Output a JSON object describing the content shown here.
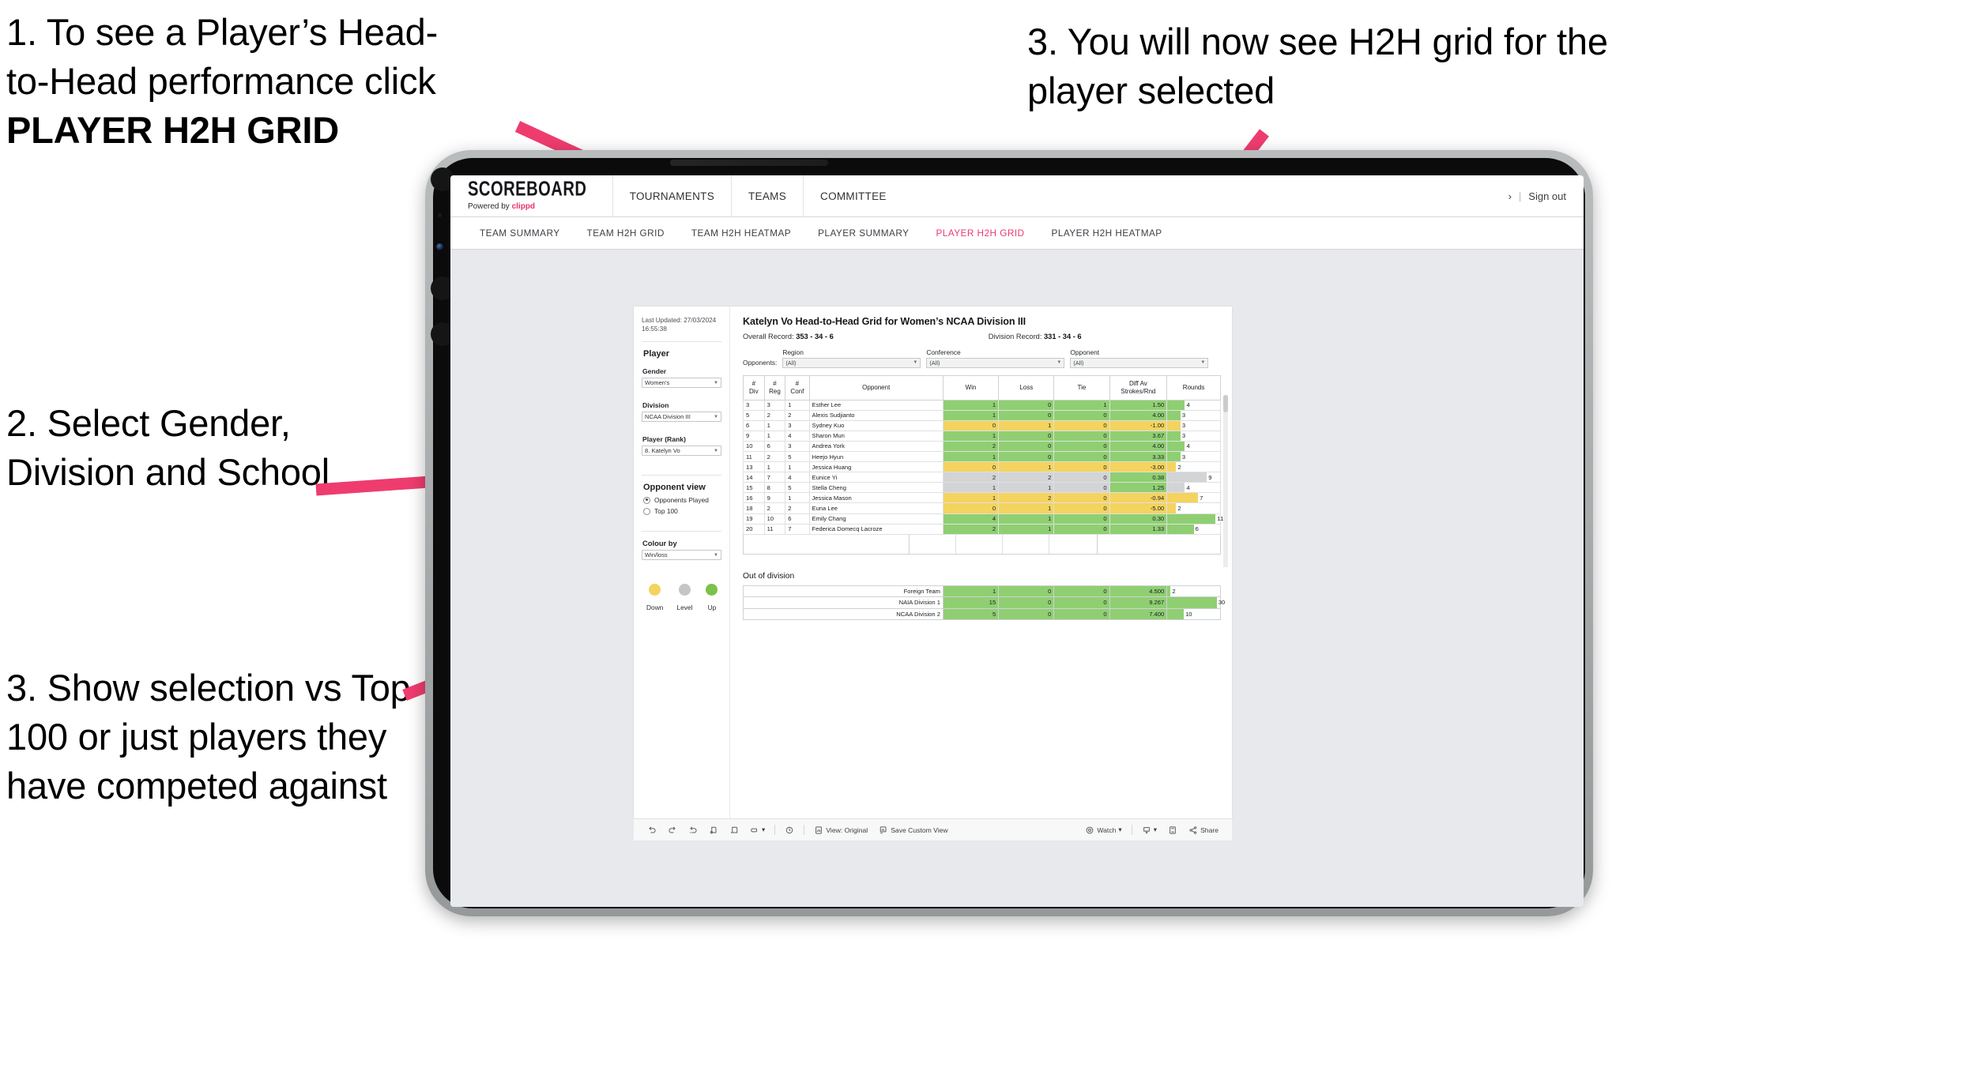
{
  "annotations": {
    "step1_line1": "1. To see a Player’s Head-",
    "step1_line2": "to-Head performance click",
    "step1_bold": "PLAYER H2H GRID",
    "step2": "2. Select Gender, Division and School",
    "step3_left": "3. Show selection vs Top 100 or just players they have competed against",
    "step3_right": "3. You will now see H2H grid for the player selected"
  },
  "app": {
    "brand": "SCOREBOARD",
    "brand_sub_prefix": "Powered by ",
    "brand_sub_accent": "clippd",
    "accent_color": "#e8336d",
    "nav": [
      {
        "label": "TOURNAMENTS"
      },
      {
        "label": "TEAMS"
      },
      {
        "label": "COMMITTEE"
      }
    ],
    "header_right": {
      "chevron": "›",
      "separator": "|",
      "sign_out": "Sign out"
    },
    "tabs": [
      {
        "label": "TEAM SUMMARY",
        "active": false
      },
      {
        "label": "TEAM H2H GRID",
        "active": false
      },
      {
        "label": "TEAM H2H HEATMAP",
        "active": false
      },
      {
        "label": "PLAYER SUMMARY",
        "active": false
      },
      {
        "label": "PLAYER H2H GRID",
        "active": true
      },
      {
        "label": "PLAYER H2H HEATMAP",
        "active": false
      }
    ]
  },
  "sidebar": {
    "last_updated": "Last Updated: 27/03/2024 16:55:38",
    "player_section": "Player",
    "gender_label": "Gender",
    "gender_value": "Women's",
    "division_label": "Division",
    "division_value": "NCAA Division III",
    "player_rank_label": "Player (Rank)",
    "player_rank_value": "8. Katelyn Vo",
    "opponent_view_label": "Opponent view",
    "opponent_view_options": [
      {
        "label": "Opponents Played",
        "selected": true
      },
      {
        "label": "Top 100",
        "selected": false
      }
    ],
    "colour_by_label": "Colour by",
    "colour_by_value": "Win/loss",
    "legend": [
      {
        "caption": "Down",
        "color": "#f4d35e"
      },
      {
        "caption": "Level",
        "color": "#c3c5c7"
      },
      {
        "caption": "Up",
        "color": "#7cc148"
      }
    ]
  },
  "main": {
    "title": "Katelyn Vo Head-to-Head Grid for Women’s NCAA Division III",
    "overall_record_label": "Overall Record:",
    "overall_record_value": "353 - 34 - 6",
    "division_record_label": "Division Record:",
    "division_record_value": "331 - 34 - 6",
    "opponents_label": "Opponents:",
    "filters": [
      {
        "label": "Region",
        "value": "(All)"
      },
      {
        "label": "Conference",
        "value": "(All)"
      },
      {
        "label": "Opponent",
        "value": "(All)"
      }
    ],
    "out_of_division_title": "Out of division"
  },
  "chart_data": {
    "type": "table",
    "title": "Katelyn Vo Head-to-Head Grid for Women’s NCAA Division III",
    "columns": [
      "# Div",
      "# Reg",
      "# Conf",
      "Opponent",
      "Win",
      "Loss",
      "Tie",
      "Diff Av Strokes/Rnd",
      "Rounds"
    ],
    "column_header_lines": [
      [
        "#",
        "Div"
      ],
      [
        "#",
        "Reg"
      ],
      [
        "#",
        "Conf"
      ],
      [
        "Opponent"
      ],
      [
        "Win"
      ],
      [
        "Loss"
      ],
      [
        "Tie"
      ],
      [
        "Diff Av",
        "Strokes/Rnd"
      ],
      [
        "Rounds"
      ]
    ],
    "rounds_max": 12,
    "rows": [
      {
        "div": "3",
        "reg": "3",
        "conf": "1",
        "opponent": "Esther Lee",
        "win": "1",
        "loss": "0",
        "tie": "1",
        "diff": "1.50",
        "rounds": 4,
        "state": "up"
      },
      {
        "div": "5",
        "reg": "2",
        "conf": "2",
        "opponent": "Alexis Sudjianto",
        "win": "1",
        "loss": "0",
        "tie": "0",
        "diff": "4.00",
        "rounds": 3,
        "state": "up"
      },
      {
        "div": "6",
        "reg": "1",
        "conf": "3",
        "opponent": "Sydney Kuo",
        "win": "0",
        "loss": "1",
        "tie": "0",
        "diff": "-1.00",
        "rounds": 3,
        "state": "down"
      },
      {
        "div": "9",
        "reg": "1",
        "conf": "4",
        "opponent": "Sharon Mun",
        "win": "1",
        "loss": "0",
        "tie": "0",
        "diff": "3.67",
        "rounds": 3,
        "state": "up"
      },
      {
        "div": "10",
        "reg": "6",
        "conf": "3",
        "opponent": "Andrea York",
        "win": "2",
        "loss": "0",
        "tie": "0",
        "diff": "4.00",
        "rounds": 4,
        "state": "up"
      },
      {
        "div": "11",
        "reg": "2",
        "conf": "5",
        "opponent": "Heejo Hyun",
        "win": "1",
        "loss": "0",
        "tie": "0",
        "diff": "3.33",
        "rounds": 3,
        "state": "up"
      },
      {
        "div": "13",
        "reg": "1",
        "conf": "1",
        "opponent": "Jessica Huang",
        "win": "0",
        "loss": "1",
        "tie": "0",
        "diff": "-3.00",
        "rounds": 2,
        "state": "down"
      },
      {
        "div": "14",
        "reg": "7",
        "conf": "4",
        "opponent": "Eunice Yi",
        "win": "2",
        "loss": "2",
        "tie": "0",
        "diff": "0.38",
        "rounds": 9,
        "state": "level",
        "diff_state": "up"
      },
      {
        "div": "15",
        "reg": "8",
        "conf": "5",
        "opponent": "Stella Cheng",
        "win": "1",
        "loss": "1",
        "tie": "0",
        "diff": "1.25",
        "rounds": 4,
        "state": "level",
        "diff_state": "up"
      },
      {
        "div": "16",
        "reg": "9",
        "conf": "1",
        "opponent": "Jessica Mason",
        "win": "1",
        "loss": "2",
        "tie": "0",
        "diff": "-0.94",
        "rounds": 7,
        "state": "down"
      },
      {
        "div": "18",
        "reg": "2",
        "conf": "2",
        "opponent": "Euna Lee",
        "win": "0",
        "loss": "1",
        "tie": "0",
        "diff": "-5.00",
        "rounds": 2,
        "state": "down"
      },
      {
        "div": "19",
        "reg": "10",
        "conf": "6",
        "opponent": "Emily Chang",
        "win": "4",
        "loss": "1",
        "tie": "0",
        "diff": "0.30",
        "rounds": 11,
        "state": "up"
      },
      {
        "div": "20",
        "reg": "11",
        "conf": "7",
        "opponent": "Federica Domecq Lacroze",
        "win": "2",
        "loss": "1",
        "tie": "0",
        "diff": "1.33",
        "rounds": 6,
        "state": "up"
      }
    ],
    "out_of_division": {
      "title": "Out of division",
      "rounds_max": 32,
      "rows": [
        {
          "label": "Foreign Team",
          "win": "1",
          "loss": "0",
          "tie": "0",
          "diff": "4.500",
          "rounds": 2,
          "state": "up"
        },
        {
          "label": "NAIA Division 1",
          "win": "15",
          "loss": "0",
          "tie": "0",
          "diff": "9.267",
          "rounds": 30,
          "state": "up"
        },
        {
          "label": "NCAA Division 2",
          "win": "5",
          "loss": "0",
          "tie": "0",
          "diff": "7.400",
          "rounds": 10,
          "state": "up"
        }
      ]
    }
  },
  "toolbar": {
    "view_original": "View: Original",
    "save_custom_view": "Save Custom View",
    "watch": "Watch",
    "share": "Share",
    "caret": "▾"
  }
}
